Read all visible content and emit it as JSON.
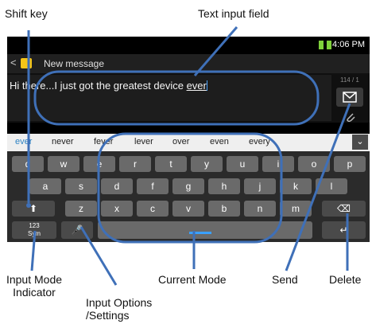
{
  "callouts": {
    "shift_key": "Shift key",
    "text_input_field": "Text input field",
    "input_mode_indicator_1": "Input Mode",
    "input_mode_indicator_2": "Indicator",
    "input_options_1": "Input Options",
    "input_options_2": "/Settings",
    "current_mode": "Current Mode",
    "send": "Send",
    "delete": "Delete"
  },
  "status_bar": {
    "time": "4:06 PM"
  },
  "title_bar": {
    "back": "<",
    "title": "New message"
  },
  "composer": {
    "text_before": "Hi there...I just got the greatest device ",
    "text_word": "ever",
    "counter": "114 / 1",
    "send_icon": "send-envelope-icon",
    "attach_icon": "paperclip-icon"
  },
  "suggestions": [
    "ever",
    "never",
    "fever",
    "lever",
    "over",
    "even",
    "every"
  ],
  "keyboard": {
    "row1": [
      "q",
      "w",
      "e",
      "r",
      "t",
      "y",
      "u",
      "i",
      "o",
      "p"
    ],
    "row2": [
      "a",
      "s",
      "d",
      "f",
      "g",
      "h",
      "j",
      "k",
      "l"
    ],
    "row3": [
      "z",
      "x",
      "c",
      "v",
      "b",
      "n",
      "m"
    ],
    "mode_key_1": "123",
    "mode_key_2": "Sym",
    "shift_glyph": "⬆",
    "mic_glyph": "🎤",
    "delete_glyph": "⌫",
    "enter_glyph": "↵"
  },
  "colors": {
    "accent_ring": "#3f70b8",
    "suggestion_highlight": "#2f84c4"
  }
}
